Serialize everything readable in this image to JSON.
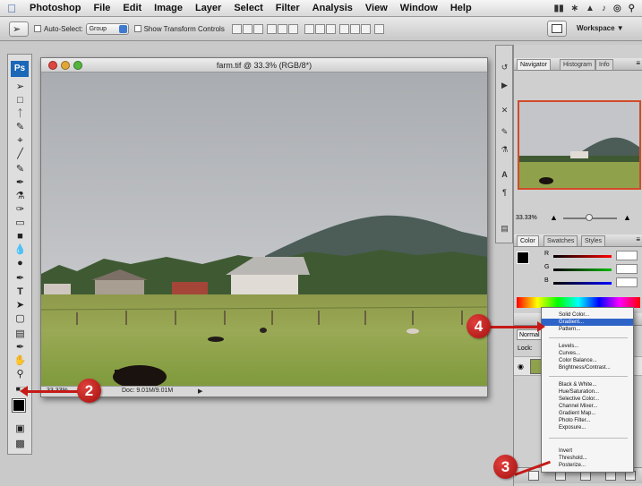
{
  "menubar": {
    "app_name": "Photoshop",
    "items": [
      "File",
      "Edit",
      "Image",
      "Layer",
      "Select",
      "Filter",
      "Analysis",
      "View",
      "Window",
      "Help"
    ]
  },
  "options_bar": {
    "auto_select_label": "Auto-Select:",
    "auto_select_value": "Group",
    "show_transform_label": "Show Transform Controls",
    "workspace_label": "Workspace"
  },
  "toolbox": {
    "logo": "Ps"
  },
  "document": {
    "title": "farm.tif @ 33.3% (RGB/8*)",
    "zoom": "33.33%",
    "doc_size": "Doc: 9.01M/9.01M"
  },
  "navigator_panel": {
    "tabs": [
      "Navigator",
      "Histogram",
      "Info"
    ],
    "zoom": "33.33%"
  },
  "color_panel": {
    "tabs": [
      "Color",
      "Swatches",
      "Styles"
    ],
    "channels": [
      "R",
      "G",
      "B"
    ]
  },
  "layers_panel": {
    "blend_mode": "Normal",
    "lock_label": "Lock:"
  },
  "adjustment_menu": {
    "groups": [
      [
        "Solid Color...",
        "Gradient...",
        "Pattern..."
      ],
      [
        "Levels...",
        "Curves...",
        "Color Balance...",
        "Brightness/Contrast..."
      ],
      [
        "Black & White...",
        "Hue/Saturation...",
        "Selective Color...",
        "Channel Mixer...",
        "Gradient Map...",
        "Photo Filter...",
        "Exposure..."
      ],
      [
        "Invert",
        "Threshold...",
        "Posterize..."
      ]
    ],
    "highlighted": "Gradient..."
  },
  "callouts": [
    "2",
    "3",
    "4"
  ],
  "colors": {
    "callout_red": "#c51a16",
    "menu_highlight": "#2e64c8",
    "ps_blue": "#1b67b8"
  }
}
